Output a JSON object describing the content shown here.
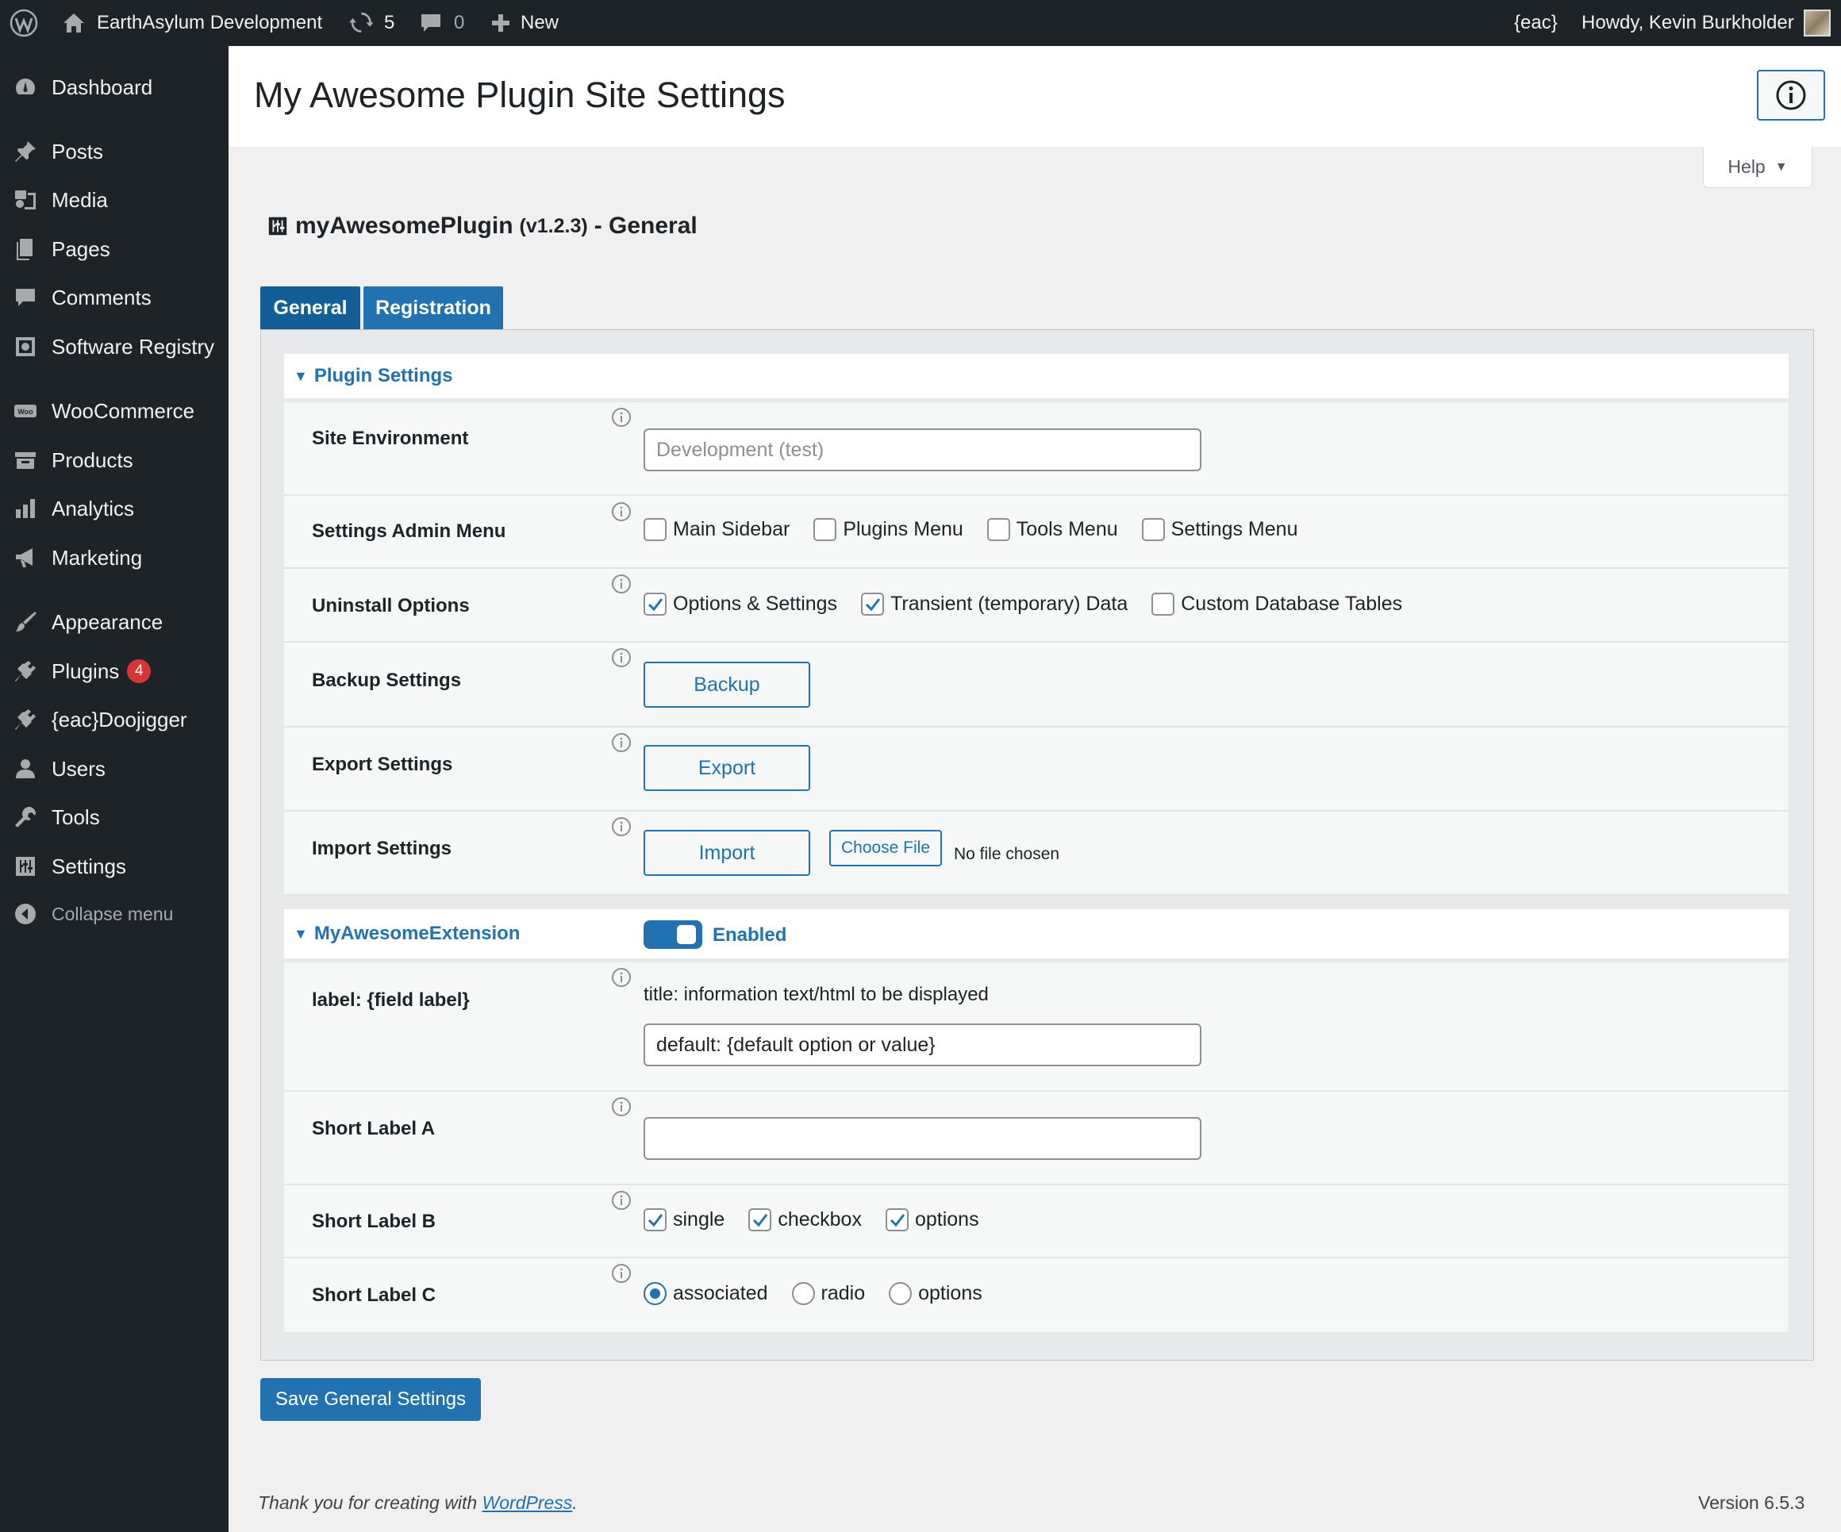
{
  "adminbar": {
    "site_name": "EarthAsylum Development",
    "updates_count": "5",
    "comments_count": "0",
    "new_label": "New",
    "eac_label": "{eac}",
    "howdy": "Howdy, Kevin Burkholder"
  },
  "sidebar": {
    "items": [
      {
        "label": "Dashboard",
        "icon": "dashboard-icon"
      },
      {
        "label": "Posts",
        "icon": "pin-icon"
      },
      {
        "label": "Media",
        "icon": "media-icon"
      },
      {
        "label": "Pages",
        "icon": "pages-icon"
      },
      {
        "label": "Comments",
        "icon": "comment-icon"
      },
      {
        "label": "Software Registry",
        "icon": "registry-icon"
      },
      {
        "label": "WooCommerce",
        "icon": "woo-icon"
      },
      {
        "label": "Products",
        "icon": "archive-icon"
      },
      {
        "label": "Analytics",
        "icon": "bar-chart-icon"
      },
      {
        "label": "Marketing",
        "icon": "megaphone-icon"
      },
      {
        "label": "Appearance",
        "icon": "brush-icon"
      },
      {
        "label": "Plugins",
        "icon": "plug-icon",
        "badge": "4"
      },
      {
        "label": "{eac}Doojigger",
        "icon": "plug-icon"
      },
      {
        "label": "Users",
        "icon": "user-icon"
      },
      {
        "label": "Tools",
        "icon": "wrench-icon"
      },
      {
        "label": "Settings",
        "icon": "sliders-icon"
      }
    ],
    "collapse_label": "Collapse menu"
  },
  "header": {
    "title": "My Awesome Plugin Site Settings",
    "help_label": "Help"
  },
  "plugin": {
    "name": "myAwesomePlugin",
    "version": "(v1.2.3)",
    "section": "- General"
  },
  "tabs": [
    {
      "label": "General",
      "active": true
    },
    {
      "label": "Registration",
      "active": false
    }
  ],
  "plugin_settings": {
    "title": "Plugin Settings",
    "site_environment": {
      "label": "Site Environment",
      "placeholder": "Development (test)"
    },
    "admin_menu": {
      "label": "Settings Admin Menu",
      "options": [
        {
          "label": "Main Sidebar",
          "checked": false
        },
        {
          "label": "Plugins Menu",
          "checked": false
        },
        {
          "label": "Tools Menu",
          "checked": false
        },
        {
          "label": "Settings Menu",
          "checked": false
        }
      ]
    },
    "uninstall": {
      "label": "Uninstall Options",
      "options": [
        {
          "label": "Options & Settings",
          "checked": true
        },
        {
          "label": "Transient (temporary) Data",
          "checked": true
        },
        {
          "label": "Custom Database Tables",
          "checked": false
        }
      ]
    },
    "backup": {
      "label": "Backup Settings",
      "button": "Backup"
    },
    "export": {
      "label": "Export Settings",
      "button": "Export"
    },
    "import": {
      "label": "Import Settings",
      "button": "Import",
      "choose_file": "Choose File",
      "file_status": "No file chosen"
    }
  },
  "extension": {
    "title": "MyAwesomeExtension",
    "enabled_label": "Enabled",
    "field": {
      "label": "label: {field label}",
      "title": "title: information text/html to be displayed",
      "value": "default: {default option or value}"
    },
    "short_a": {
      "label": "Short Label A",
      "value": ""
    },
    "short_b": {
      "label": "Short Label B",
      "options": [
        {
          "label": "single",
          "checked": true
        },
        {
          "label": "checkbox",
          "checked": true
        },
        {
          "label": "options",
          "checked": true
        }
      ]
    },
    "short_c": {
      "label": "Short Label C",
      "options": [
        {
          "label": "associated",
          "checked": true
        },
        {
          "label": "radio",
          "checked": false
        },
        {
          "label": "options",
          "checked": false
        }
      ]
    }
  },
  "save_label": "Save General Settings",
  "footer": {
    "thanks_prefix": "Thank you for creating with ",
    "thanks_link": "WordPress",
    "thanks_suffix": ".",
    "version": "Version 6.5.3"
  },
  "colors": {
    "accent": "#2271b1",
    "adminbar_bg": "#1d2327",
    "badge": "#d63638"
  }
}
